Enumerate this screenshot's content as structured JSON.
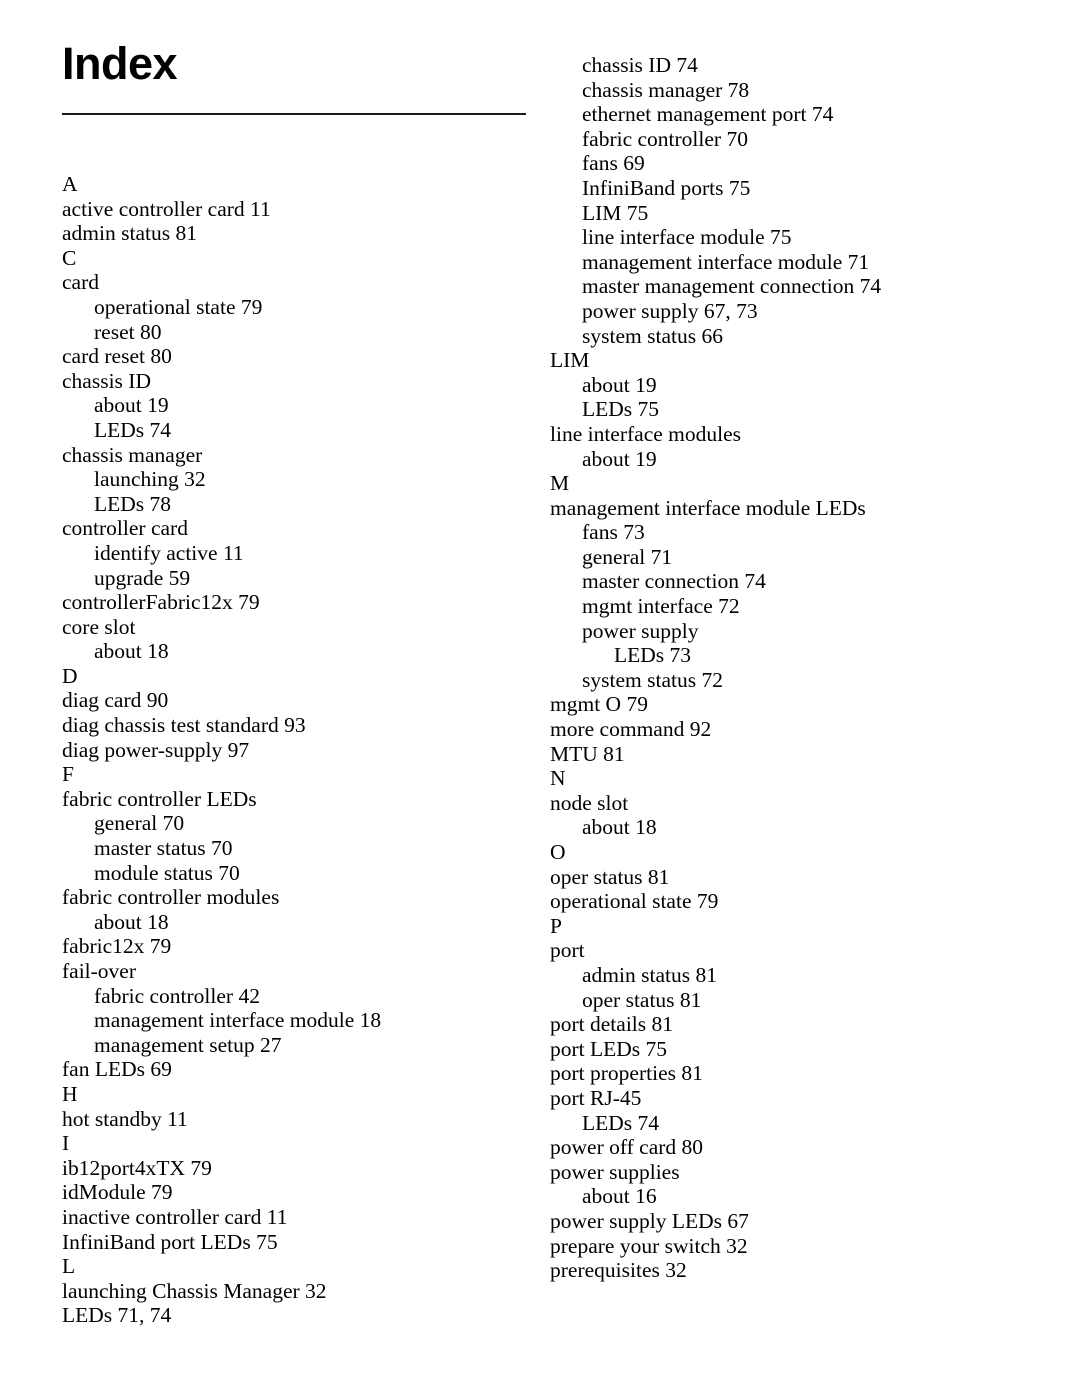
{
  "document": {
    "title": "Index",
    "rule_color": "#1a1a1a",
    "background": "#ffffff",
    "text_color": "#000000"
  },
  "columns": {
    "left": [
      {
        "type": "letter",
        "level": 0,
        "text": "A"
      },
      {
        "type": "entry",
        "level": 0,
        "text": "active controller card 11"
      },
      {
        "type": "entry",
        "level": 0,
        "text": "admin status 81"
      },
      {
        "type": "letter",
        "level": 0,
        "text": "C"
      },
      {
        "type": "entry",
        "level": 0,
        "text": "card"
      },
      {
        "type": "entry",
        "level": 1,
        "text": "operational state 79"
      },
      {
        "type": "entry",
        "level": 1,
        "text": "reset 80"
      },
      {
        "type": "entry",
        "level": 0,
        "text": "card reset 80"
      },
      {
        "type": "entry",
        "level": 0,
        "text": "chassis ID"
      },
      {
        "type": "entry",
        "level": 1,
        "text": "about 19"
      },
      {
        "type": "entry",
        "level": 1,
        "text": "LEDs 74"
      },
      {
        "type": "entry",
        "level": 0,
        "text": "chassis manager"
      },
      {
        "type": "entry",
        "level": 1,
        "text": "launching 32"
      },
      {
        "type": "entry",
        "level": 1,
        "text": "LEDs 78"
      },
      {
        "type": "entry",
        "level": 0,
        "text": "controller card"
      },
      {
        "type": "entry",
        "level": 1,
        "text": "identify active 11"
      },
      {
        "type": "entry",
        "level": 1,
        "text": "upgrade 59"
      },
      {
        "type": "entry",
        "level": 0,
        "text": "controllerFabric12x 79"
      },
      {
        "type": "entry",
        "level": 0,
        "text": "core slot"
      },
      {
        "type": "entry",
        "level": 1,
        "text": "about 18"
      },
      {
        "type": "letter",
        "level": 0,
        "text": "D"
      },
      {
        "type": "entry",
        "level": 0,
        "text": "diag card 90"
      },
      {
        "type": "entry",
        "level": 0,
        "text": "diag chassis test standard 93"
      },
      {
        "type": "entry",
        "level": 0,
        "text": "diag power-supply 97"
      },
      {
        "type": "letter",
        "level": 0,
        "text": "F"
      },
      {
        "type": "entry",
        "level": 0,
        "text": "fabric controller LEDs"
      },
      {
        "type": "entry",
        "level": 1,
        "text": "general 70"
      },
      {
        "type": "entry",
        "level": 1,
        "text": "master status 70"
      },
      {
        "type": "entry",
        "level": 1,
        "text": "module status 70"
      },
      {
        "type": "entry",
        "level": 0,
        "text": "fabric controller modules"
      },
      {
        "type": "entry",
        "level": 1,
        "text": "about 18"
      },
      {
        "type": "entry",
        "level": 0,
        "text": "fabric12x 79"
      },
      {
        "type": "entry",
        "level": 0,
        "text": "fail-over"
      },
      {
        "type": "entry",
        "level": 1,
        "text": "fabric controller 42"
      },
      {
        "type": "entry",
        "level": 1,
        "text": "management interface module 18"
      },
      {
        "type": "entry",
        "level": 1,
        "text": "management setup 27"
      },
      {
        "type": "entry",
        "level": 0,
        "text": "fan LEDs 69"
      },
      {
        "type": "letter",
        "level": 0,
        "text": "H"
      },
      {
        "type": "entry",
        "level": 0,
        "text": "hot standby 11"
      },
      {
        "type": "letter",
        "level": 0,
        "text": "I"
      },
      {
        "type": "entry",
        "level": 0,
        "text": "ib12port4xTX 79"
      },
      {
        "type": "entry",
        "level": 0,
        "text": "idModule 79"
      },
      {
        "type": "entry",
        "level": 0,
        "text": "inactive controller card 11"
      },
      {
        "type": "entry",
        "level": 0,
        "text": "InfiniBand port LEDs 75"
      },
      {
        "type": "letter",
        "level": 0,
        "text": "L"
      },
      {
        "type": "entry",
        "level": 0,
        "text": "launching Chassis Manager 32"
      },
      {
        "type": "entry",
        "level": 0,
        "text": "LEDs 71, 74"
      }
    ],
    "right": [
      {
        "type": "entry",
        "level": 1,
        "text": "chassis ID 74"
      },
      {
        "type": "entry",
        "level": 1,
        "text": "chassis manager 78"
      },
      {
        "type": "entry",
        "level": 1,
        "text": "ethernet management port 74"
      },
      {
        "type": "entry",
        "level": 1,
        "text": "fabric controller 70"
      },
      {
        "type": "entry",
        "level": 1,
        "text": "fans 69"
      },
      {
        "type": "entry",
        "level": 1,
        "text": "InfiniBand ports 75"
      },
      {
        "type": "entry",
        "level": 1,
        "text": "LIM 75"
      },
      {
        "type": "entry",
        "level": 1,
        "text": "line interface module 75"
      },
      {
        "type": "entry",
        "level": 1,
        "text": "management interface module 71"
      },
      {
        "type": "entry",
        "level": 1,
        "text": "master management connection 74"
      },
      {
        "type": "entry",
        "level": 1,
        "text": "power supply 67, 73"
      },
      {
        "type": "entry",
        "level": 1,
        "text": "system status 66"
      },
      {
        "type": "entry",
        "level": 0,
        "text": "LIM"
      },
      {
        "type": "entry",
        "level": 1,
        "text": "about 19"
      },
      {
        "type": "entry",
        "level": 1,
        "text": "LEDs 75"
      },
      {
        "type": "entry",
        "level": 0,
        "text": "line interface modules"
      },
      {
        "type": "entry",
        "level": 1,
        "text": "about 19"
      },
      {
        "type": "letter",
        "level": 0,
        "text": "M"
      },
      {
        "type": "entry",
        "level": 0,
        "text": "management interface module LEDs"
      },
      {
        "type": "entry",
        "level": 1,
        "text": "fans 73"
      },
      {
        "type": "entry",
        "level": 1,
        "text": "general 71"
      },
      {
        "type": "entry",
        "level": 1,
        "text": "master connection 74"
      },
      {
        "type": "entry",
        "level": 1,
        "text": "mgmt interface 72"
      },
      {
        "type": "entry",
        "level": 1,
        "text": "power supply"
      },
      {
        "type": "entry",
        "level": 2,
        "text": "LEDs 73"
      },
      {
        "type": "entry",
        "level": 1,
        "text": "system status 72"
      },
      {
        "type": "entry",
        "level": 0,
        "text": "mgmt O 79"
      },
      {
        "type": "entry",
        "level": 0,
        "text": "more command 92"
      },
      {
        "type": "entry",
        "level": 0,
        "text": "MTU 81"
      },
      {
        "type": "letter",
        "level": 0,
        "text": "N"
      },
      {
        "type": "entry",
        "level": 0,
        "text": "node slot"
      },
      {
        "type": "entry",
        "level": 1,
        "text": "about 18"
      },
      {
        "type": "letter",
        "level": 0,
        "text": "O"
      },
      {
        "type": "entry",
        "level": 0,
        "text": "oper status 81"
      },
      {
        "type": "entry",
        "level": 0,
        "text": "operational state 79"
      },
      {
        "type": "letter",
        "level": 0,
        "text": "P"
      },
      {
        "type": "entry",
        "level": 0,
        "text": "port"
      },
      {
        "type": "entry",
        "level": 1,
        "text": "admin status 81"
      },
      {
        "type": "entry",
        "level": 1,
        "text": "oper status 81"
      },
      {
        "type": "entry",
        "level": 0,
        "text": "port details 81"
      },
      {
        "type": "entry",
        "level": 0,
        "text": "port LEDs 75"
      },
      {
        "type": "entry",
        "level": 0,
        "text": "port properties 81"
      },
      {
        "type": "entry",
        "level": 0,
        "text": "port RJ-45"
      },
      {
        "type": "entry",
        "level": 1,
        "text": "LEDs 74"
      },
      {
        "type": "entry",
        "level": 0,
        "text": "power off card 80"
      },
      {
        "type": "entry",
        "level": 0,
        "text": "power supplies"
      },
      {
        "type": "entry",
        "level": 1,
        "text": "about 16"
      },
      {
        "type": "entry",
        "level": 0,
        "text": "power supply LEDs 67"
      },
      {
        "type": "entry",
        "level": 0,
        "text": "prepare your switch 32"
      },
      {
        "type": "entry",
        "level": 0,
        "text": "prerequisites 32"
      }
    ]
  }
}
